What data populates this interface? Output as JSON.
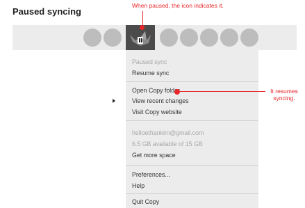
{
  "title": "Paused syncing",
  "annotations": {
    "top": "When paused, the icon indicates it.",
    "right_line1": "It resumes",
    "right_line2": "syncing."
  },
  "menubar": {
    "app_icon": "copy-paused-icon"
  },
  "menu": {
    "status": "Paused sync",
    "resume": "Resume sync",
    "open_folder": "Open Copy folder",
    "recent_changes": "View recent changes",
    "visit_site": "Visit Copy website",
    "account_email": "helloethankim@gmail.com",
    "storage": "6.5 GB available of 15 GB",
    "get_more_space": "Get more space",
    "preferences": "Preferences...",
    "help": "Help",
    "quit": "Quit Copy"
  },
  "colors": {
    "annotation": "#e8262a",
    "menu_bg": "#ececec",
    "app_icon_bg": "#4b4b4b"
  }
}
